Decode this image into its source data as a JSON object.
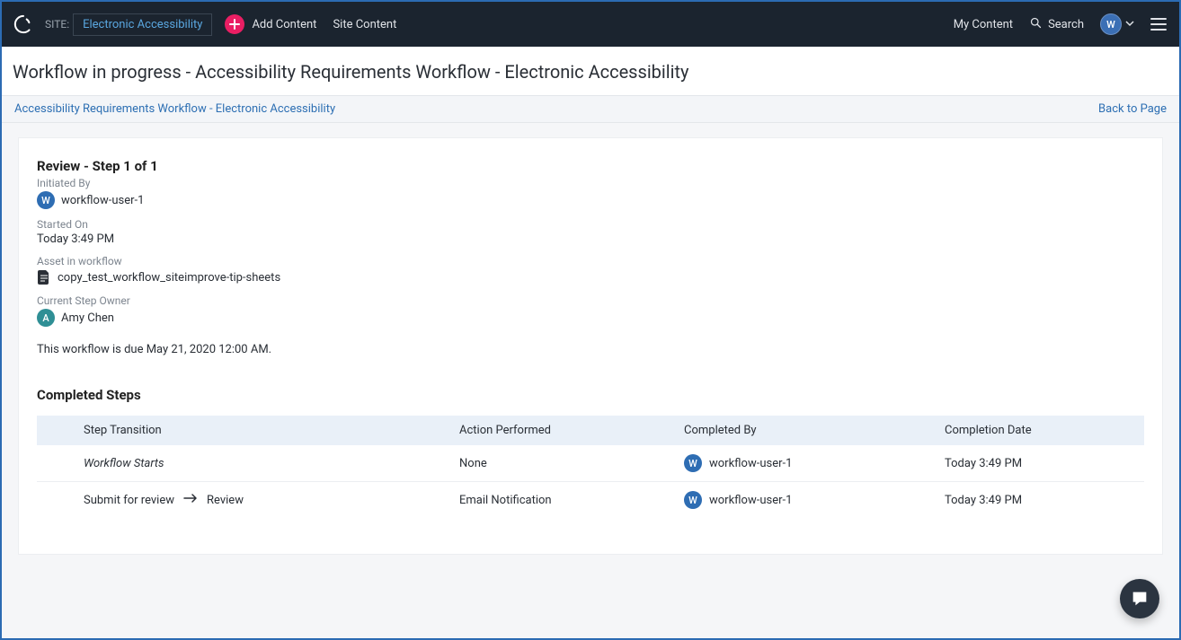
{
  "topbar": {
    "site_label": "SITE:",
    "site_name": "Electronic Accessibility",
    "add_content": "Add Content",
    "site_content": "Site Content",
    "my_content": "My Content",
    "search": "Search",
    "user_initial": "W"
  },
  "page": {
    "title": "Workflow in progress - Accessibility Requirements Workflow - Electronic Accessibility",
    "breadcrumb": "Accessibility Requirements Workflow - Electronic Accessibility",
    "back_link": "Back to Page"
  },
  "review": {
    "heading": "Review - Step 1 of 1",
    "initiated_by_label": "Initiated By",
    "initiated_by_initial": "W",
    "initiated_by_name": "workflow-user-1",
    "started_on_label": "Started On",
    "started_on": "Today 3:49 PM",
    "asset_label": "Asset in workflow",
    "asset_name": "copy_test_workflow_siteimprove-tip-sheets",
    "owner_label": "Current Step Owner",
    "owner_initial": "A",
    "owner_name": "Amy Chen",
    "due_text": "This workflow is due May 21, 2020 12:00 AM."
  },
  "completed": {
    "heading": "Completed Steps",
    "headers": {
      "step": "Step Transition",
      "action": "Action Performed",
      "by": "Completed By",
      "date": "Completion Date"
    },
    "rows": [
      {
        "step_from": "Workflow Starts",
        "step_to": "",
        "action": "None",
        "by_initial": "W",
        "by_name": "workflow-user-1",
        "date": "Today 3:49 PM",
        "italic": true
      },
      {
        "step_from": "Submit for review",
        "step_to": "Review",
        "action": "Email Notification",
        "by_initial": "W",
        "by_name": "workflow-user-1",
        "date": "Today 3:49 PM",
        "italic": false
      }
    ]
  }
}
